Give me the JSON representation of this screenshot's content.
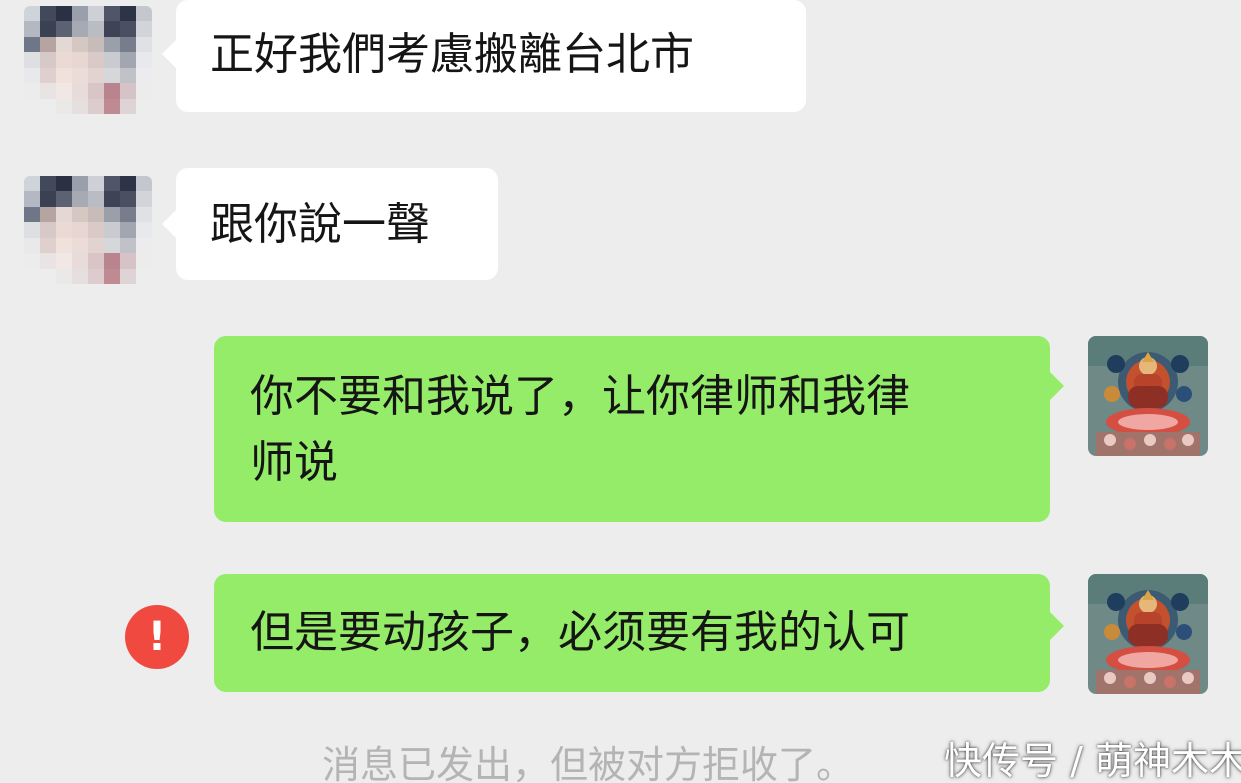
{
  "colors": {
    "background": "#ededed",
    "incoming_bubble": "#ffffff",
    "outgoing_bubble": "#95ec69",
    "error": "#f04a40",
    "system_text": "#b4b4b4"
  },
  "messages": [
    {
      "direction": "incoming",
      "text": "正好我們考慮搬離台北市",
      "avatar": "pixelated-avatar"
    },
    {
      "direction": "incoming",
      "text": "跟你說一聲",
      "avatar": "pixelated-avatar"
    },
    {
      "direction": "outgoing",
      "line1": "你不要和我说了，让你律师和我律",
      "line2": "师说",
      "avatar": "thangka-avatar"
    },
    {
      "direction": "outgoing",
      "text": "但是要动孩子，必须要有我的认可",
      "avatar": "thangka-avatar",
      "status": "failed",
      "status_icon": "exclamation-icon",
      "status_glyph": "!"
    }
  ],
  "system_note": "消息已发出，但被对方拒收了。",
  "watermark": "快传号 / 萌神木木"
}
